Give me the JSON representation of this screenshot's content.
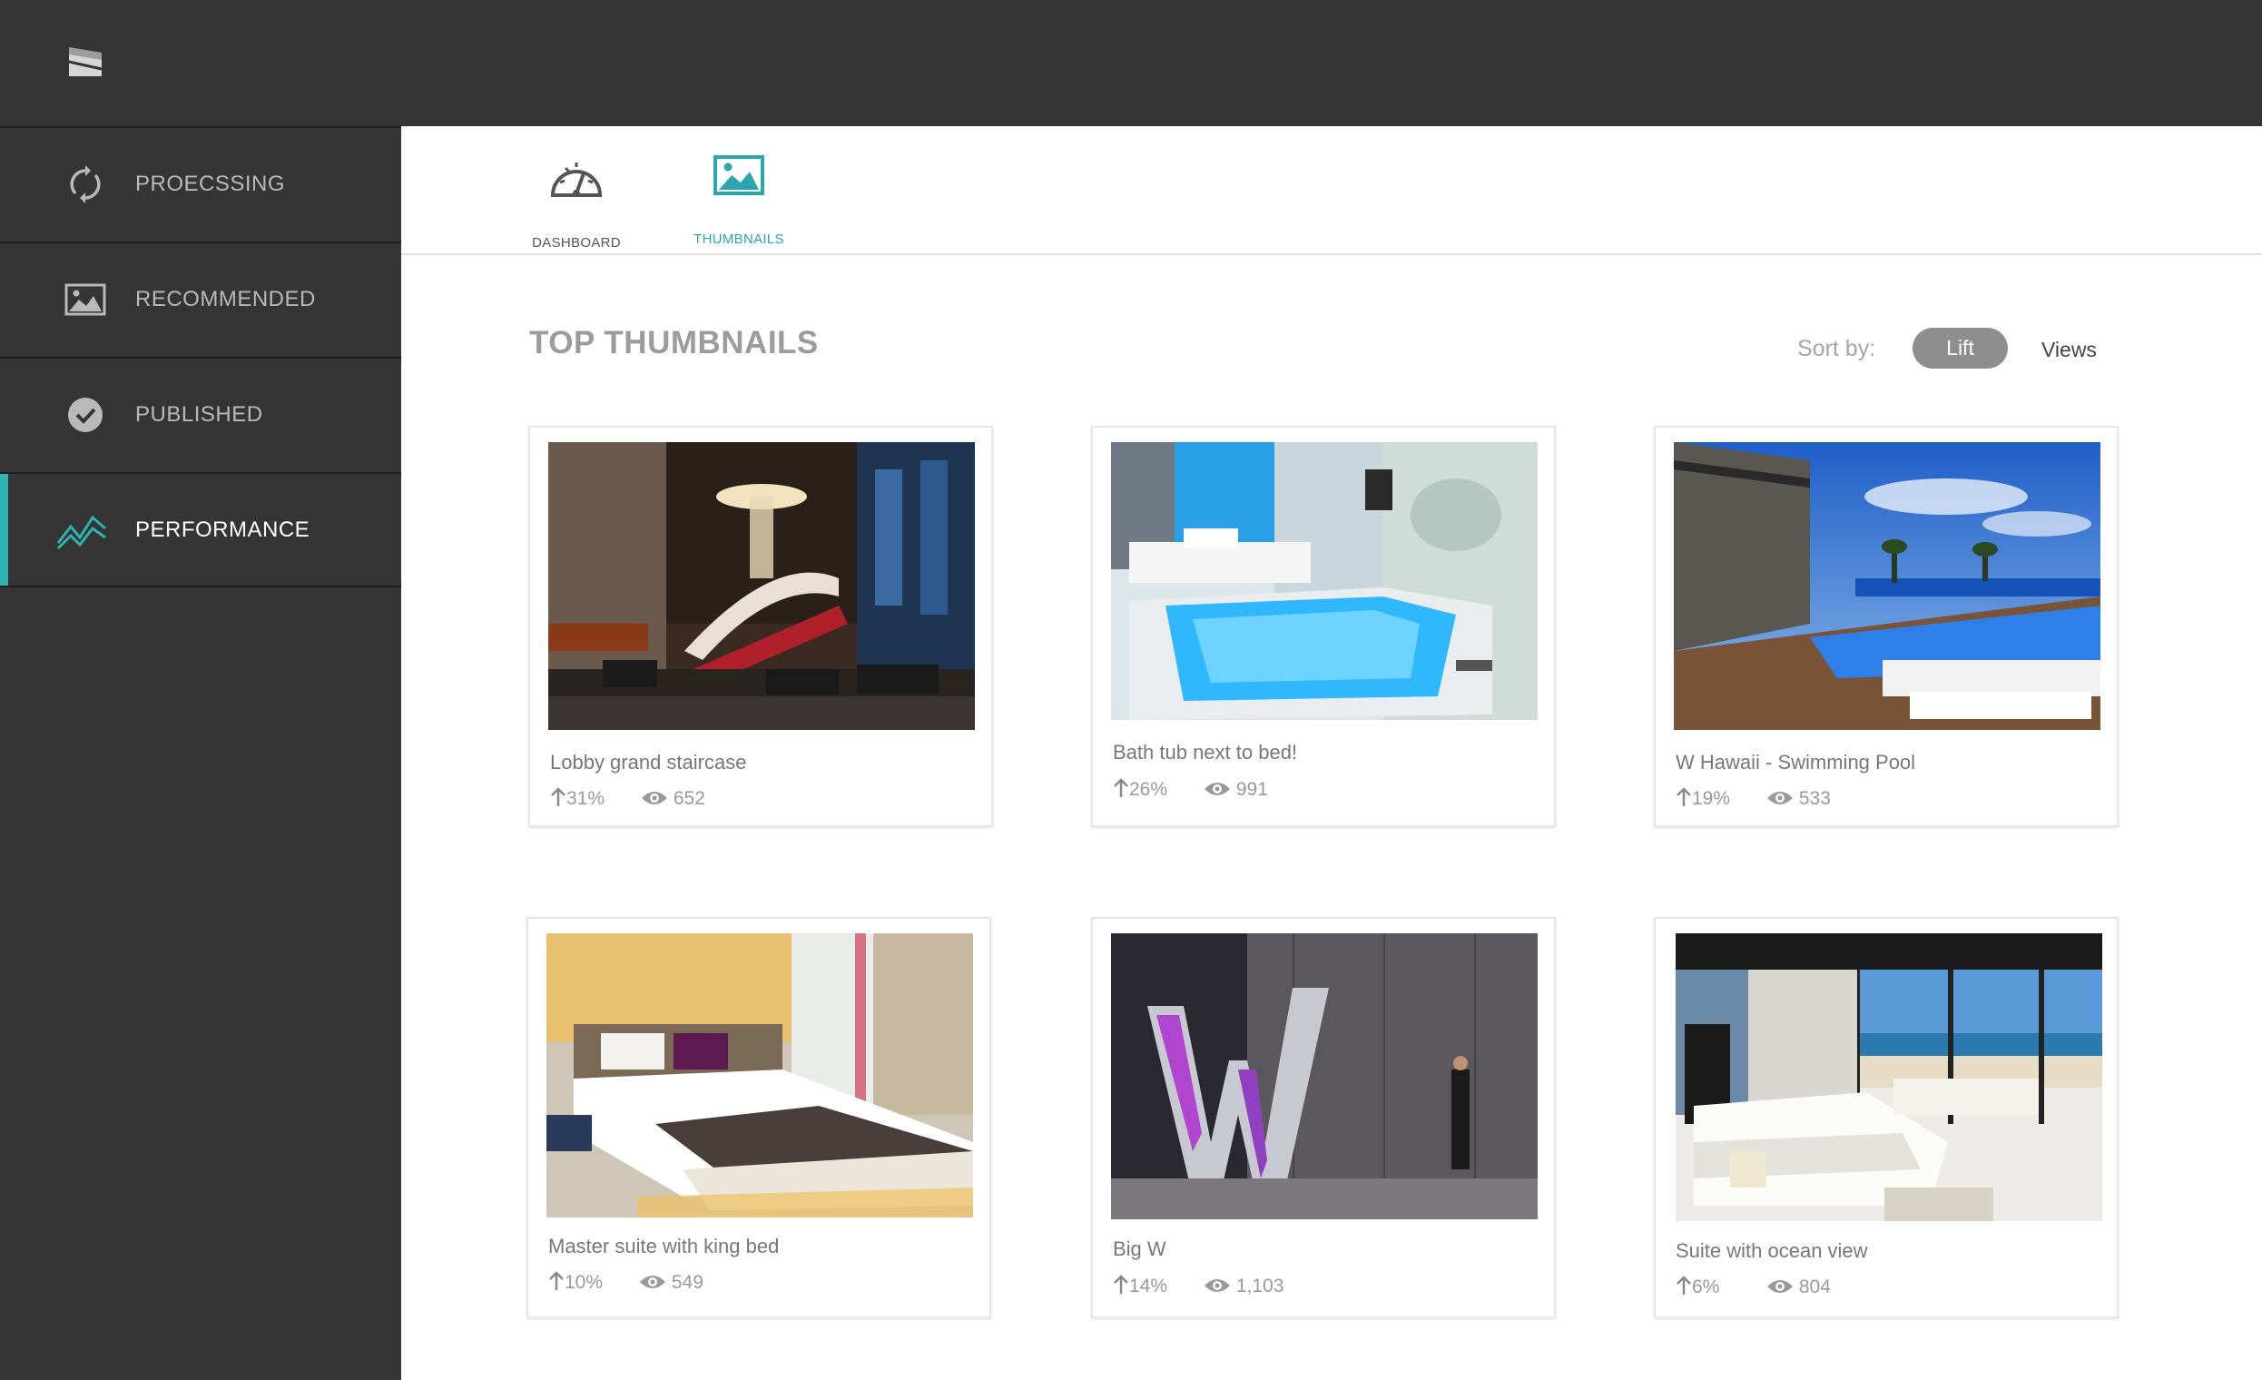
{
  "sidebar": {
    "items": [
      {
        "label": "PROECSSING",
        "icon": "refresh-icon"
      },
      {
        "label": "RECOMMENDED",
        "icon": "image-icon"
      },
      {
        "label": "PUBLISHED",
        "icon": "check-circle-icon"
      },
      {
        "label": "PERFORMANCE",
        "icon": "line-chart-icon",
        "active": true
      }
    ]
  },
  "tabs": [
    {
      "label": "DASHBOARD",
      "icon": "gauge-icon"
    },
    {
      "label": "THUMBNAILS",
      "icon": "image-icon",
      "active": true
    }
  ],
  "main": {
    "title": "TOP THUMBNAILS",
    "sort": {
      "label": "Sort by:",
      "options": [
        "Lift",
        "Views"
      ],
      "selected": "Lift"
    }
  },
  "cards": [
    {
      "caption": "Lobby grand staircase",
      "lift": "31%",
      "views": "652"
    },
    {
      "caption": "Bath tub next to bed!",
      "lift": "26%",
      "views": "991"
    },
    {
      "caption": "W Hawaii - Swimming Pool",
      "lift": "19%",
      "views": "533"
    },
    {
      "caption": "Master suite with king bed",
      "lift": "10%",
      "views": "549"
    },
    {
      "caption": "Big W",
      "lift": "14%",
      "views": "1,103"
    },
    {
      "caption": "Suite with ocean view",
      "lift": "6%",
      "views": "804"
    }
  ],
  "colors": {
    "accent": "#2db3b3",
    "sidebar": "#353535",
    "pill": "#8e8e8e"
  }
}
